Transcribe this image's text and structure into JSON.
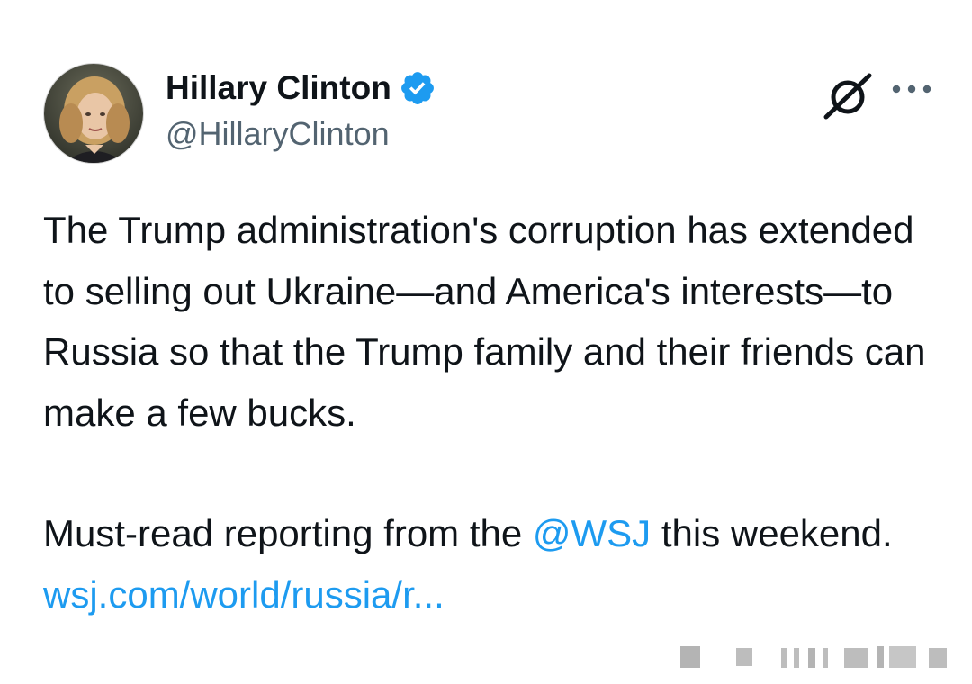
{
  "tweet": {
    "author": {
      "display_name": "Hillary Clinton",
      "handle": "@HillaryClinton",
      "verified_color": "#1d9bf0"
    },
    "icons": {
      "grok": "grok-icon",
      "more": "more-icon"
    },
    "body": {
      "paragraph1": "The Trump administration's corruption has extended to selling out Ukraine—and America's interests—to Russia so that the Trump family and their friends can make a few bucks.",
      "paragraph2_pre": "Must-read reporting from the ",
      "mention": "@WSJ",
      "paragraph2_mid": " this weekend. ",
      "link": "wsj.com/world/russia/r..."
    },
    "colors": {
      "text": "#0f1419",
      "secondary": "#536471",
      "accent": "#1d9bf0"
    }
  }
}
